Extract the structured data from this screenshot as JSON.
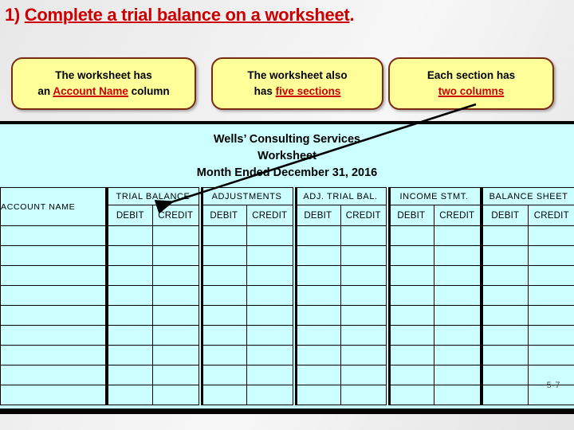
{
  "slide": {
    "title_number": "1)",
    "title_text": "Complete a trial balance on a worksheet",
    "title_period": ".",
    "page_number": "5-7",
    "accent_red": "#cc0000",
    "callout_fill": "#ffff99",
    "callout_border": "#7b2a12",
    "worksheet_fill": "#ccffff"
  },
  "callouts": [
    {
      "line1": "The worksheet has",
      "line2_pre": "an ",
      "line2_highlight": "Account Name",
      "line2_post": " column"
    },
    {
      "line1": "The worksheet also",
      "line2_pre": "has ",
      "line2_highlight": "five sections",
      "line2_post": ""
    },
    {
      "line1": "Each section has",
      "line2_pre": "",
      "line2_highlight": "two columns",
      "line2_post": ""
    }
  ],
  "worksheet": {
    "company": "Wells’ Consulting Services",
    "doc_type": "Worksheet",
    "period": "Month Ended December 31, 2016",
    "account_column_header": "ACCOUNT NAME",
    "sections": [
      {
        "name": "TRIAL BALANCE",
        "debit": "DEBIT",
        "credit": "CREDIT"
      },
      {
        "name": "ADJUSTMENTS",
        "debit": "DEBIT",
        "credit": "CREDIT"
      },
      {
        "name": "ADJ. TRIAL BAL.",
        "debit": "DEBIT",
        "credit": "CREDIT"
      },
      {
        "name": "INCOME STMT.",
        "debit": "DEBIT",
        "credit": "CREDIT"
      },
      {
        "name": "BALANCE SHEET",
        "debit": "DEBIT",
        "credit": "CREDIT"
      }
    ],
    "empty_row_count": 9,
    "rows": [
      {
        "account": "",
        "cells": [
          "",
          "",
          "",
          "",
          "",
          "",
          "",
          "",
          "",
          ""
        ]
      },
      {
        "account": "",
        "cells": [
          "",
          "",
          "",
          "",
          "",
          "",
          "",
          "",
          "",
          ""
        ]
      },
      {
        "account": "",
        "cells": [
          "",
          "",
          "",
          "",
          "",
          "",
          "",
          "",
          "",
          ""
        ]
      },
      {
        "account": "",
        "cells": [
          "",
          "",
          "",
          "",
          "",
          "",
          "",
          "",
          "",
          ""
        ]
      },
      {
        "account": "",
        "cells": [
          "",
          "",
          "",
          "",
          "",
          "",
          "",
          "",
          "",
          ""
        ]
      },
      {
        "account": "",
        "cells": [
          "",
          "",
          "",
          "",
          "",
          "",
          "",
          "",
          "",
          ""
        ]
      },
      {
        "account": "",
        "cells": [
          "",
          "",
          "",
          "",
          "",
          "",
          "",
          "",
          "",
          ""
        ]
      },
      {
        "account": "",
        "cells": [
          "",
          "",
          "",
          "",
          "",
          "",
          "",
          "",
          "",
          ""
        ]
      },
      {
        "account": "",
        "cells": [
          "",
          "",
          "",
          "",
          "",
          "",
          "",
          "",
          "",
          ""
        ]
      }
    ]
  },
  "annotation": {
    "leader_label": "pointer from two-columns callout to trial balance columns"
  }
}
